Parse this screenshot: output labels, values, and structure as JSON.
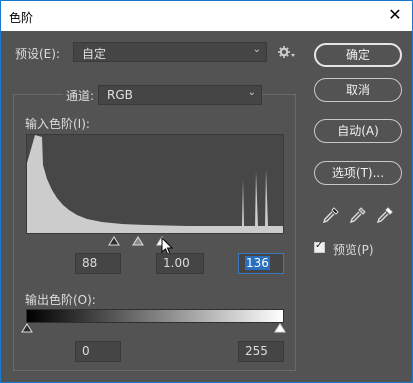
{
  "window": {
    "title": "色阶",
    "close_label": "✕"
  },
  "preset": {
    "label": "预设(E):",
    "value": "自定",
    "options_icon": "gear-icon"
  },
  "channel": {
    "label": "通道:",
    "value": "RGB"
  },
  "input_levels": {
    "label": "输入色阶(I):",
    "shadow": "88",
    "midtone": "1.00",
    "highlight": "136"
  },
  "output_levels": {
    "label": "输出色阶(O):",
    "low": "0",
    "high": "255"
  },
  "buttons": {
    "ok": "确定",
    "cancel": "取消",
    "auto": "自动(A)",
    "options": "选项(T)..."
  },
  "preview": {
    "label": "预览(P)",
    "checked": true
  },
  "eyedroppers": [
    "black-point-eyedropper-icon",
    "gray-point-eyedropper-icon",
    "white-point-eyedropper-icon"
  ],
  "colors": {
    "dialog_bg": "#535353",
    "field_bg": "#454545",
    "histogram_fill": "#cccccc",
    "highlight": "#2a6fbe"
  }
}
